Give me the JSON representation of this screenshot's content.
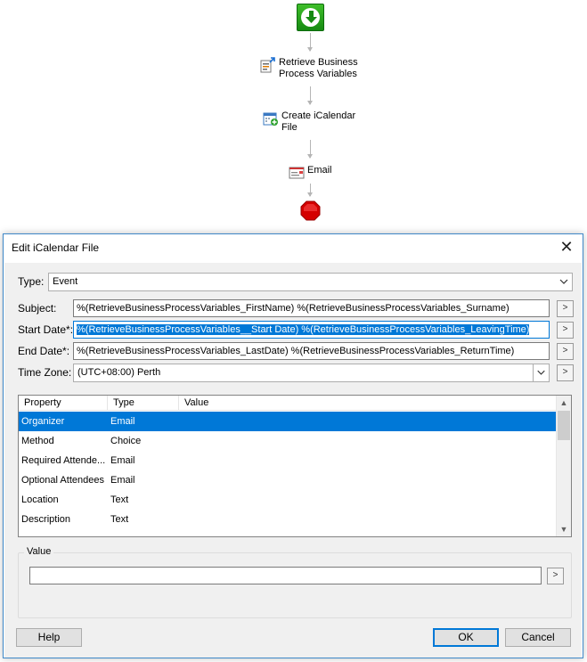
{
  "workflow": {
    "nodes": [
      {
        "label_1": "Retrieve Business",
        "label_2": "Process Variables",
        "icon": "retrieve-variables-icon"
      },
      {
        "label_1": "Create iCalendar",
        "label_2": "File",
        "icon": "create-icalendar-icon"
      },
      {
        "label_1": "Email",
        "icon": "email-icon"
      }
    ],
    "start_icon": "start-icon",
    "stop_icon": "stop-icon",
    "colors": {
      "start": "#1a9a14",
      "stop": "#d40000",
      "connector": "#b5b5b5"
    }
  },
  "dialog": {
    "title": "Edit  iCalendar File",
    "close_glyph": "✕",
    "type": {
      "label": "Type:",
      "value": "Event"
    },
    "subject": {
      "label": "Subject:",
      "value": "%(RetrieveBusinessProcessVariables_FirstName)  %(RetrieveBusinessProcessVariables_Surname)"
    },
    "start_date": {
      "label": "Start Date*:",
      "value": "%(RetrieveBusinessProcessVariables__Start Date) %(RetrieveBusinessProcessVariables_LeavingTime)"
    },
    "end_date": {
      "label": "End Date*:",
      "value": "%(RetrieveBusinessProcessVariables_LastDate) %(RetrieveBusinessProcessVariables_ReturnTime)"
    },
    "time_zone": {
      "label": "Time Zone:",
      "value": "(UTC+08:00) Perth"
    },
    "picker_glyph": ">",
    "grid": {
      "headers": [
        "Property",
        "Type",
        "Value"
      ],
      "rows": [
        {
          "property": "Organizer",
          "type": "Email",
          "value": "",
          "selected": true
        },
        {
          "property": "Method",
          "type": "Choice",
          "value": ""
        },
        {
          "property": "Required Attende...",
          "type": "Email",
          "value": ""
        },
        {
          "property": "Optional Attendees",
          "type": "Email",
          "value": ""
        },
        {
          "property": "Location",
          "type": "Text",
          "value": ""
        },
        {
          "property": "Description",
          "type": "Text",
          "value": ""
        }
      ]
    },
    "value_group": {
      "legend": "Value",
      "value": ""
    },
    "buttons": {
      "help": "Help",
      "ok": "OK",
      "cancel": "Cancel"
    },
    "accent": "#0078d7"
  }
}
